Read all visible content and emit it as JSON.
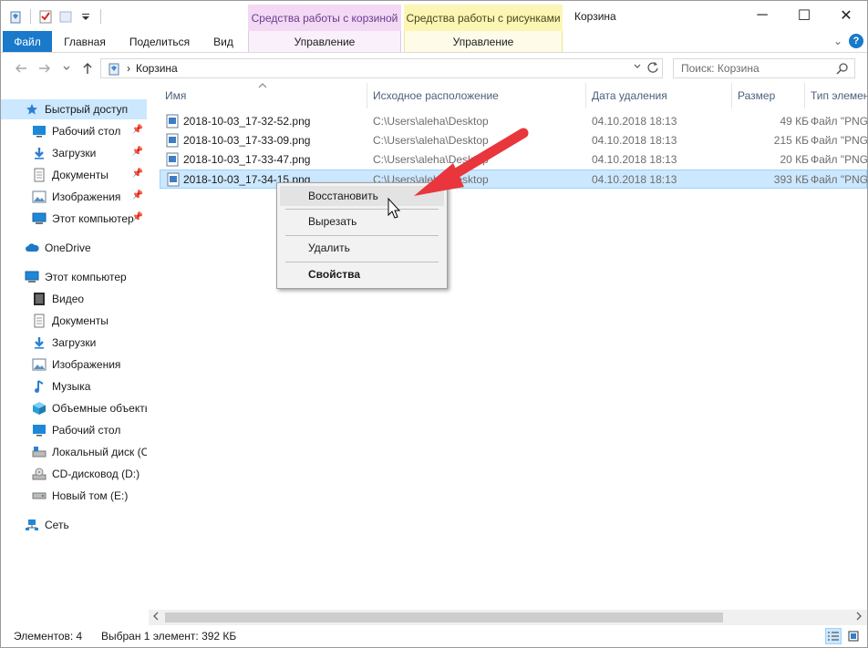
{
  "window": {
    "title": "Корзина",
    "minimize": "─",
    "maximize": "☐",
    "close": "✕"
  },
  "context_tabs": {
    "recycle_tools": "Средства работы с корзиной",
    "picture_tools": "Средства работы с рисунками"
  },
  "ribbon": {
    "file": "Файл",
    "home": "Главная",
    "share": "Поделиться",
    "view": "Вид",
    "manage1": "Управление",
    "manage2": "Управление",
    "collapse": "⌄",
    "help": "?"
  },
  "address": {
    "separator": "›",
    "location": "Корзина",
    "search_placeholder": "Поиск: Корзина"
  },
  "nav": {
    "quick_access": "Быстрый доступ",
    "desktop_pinned": "Рабочий стол",
    "downloads_pinned": "Загрузки",
    "documents_pinned": "Документы",
    "images_pinned": "Изображения",
    "this_pc_pinned": "Этот компьютер",
    "onedrive": "OneDrive",
    "this_pc": "Этот компьютер",
    "video": "Видео",
    "documents": "Документы",
    "downloads": "Загрузки",
    "images": "Изображения",
    "music": "Музыка",
    "objects3d": "Объемные объекты",
    "desktop": "Рабочий стол",
    "local_disk": "Локальный диск (C:)",
    "cd_drive": "CD-дисковод (D:)",
    "new_volume": "Новый том (E:)",
    "network": "Сеть"
  },
  "columns": {
    "name": "Имя",
    "origin": "Исходное расположение",
    "deleted": "Дата удаления",
    "size": "Размер",
    "type": "Тип элемента"
  },
  "files": [
    {
      "name": "2018-10-03_17-32-52.png",
      "origin": "C:\\Users\\aleha\\Desktop",
      "deleted": "04.10.2018 18:13",
      "size": "49 КБ",
      "type": "Файл \"PNG\""
    },
    {
      "name": "2018-10-03_17-33-09.png",
      "origin": "C:\\Users\\aleha\\Desktop",
      "deleted": "04.10.2018 18:13",
      "size": "215 КБ",
      "type": "Файл \"PNG\""
    },
    {
      "name": "2018-10-03_17-33-47.png",
      "origin": "C:\\Users\\aleha\\Desktop",
      "deleted": "04.10.2018 18:13",
      "size": "20 КБ",
      "type": "Файл \"PNG\""
    },
    {
      "name": "2018-10-03_17-34-15.png",
      "origin": "C:\\Users\\aleha\\Desktop",
      "deleted": "04.10.2018 18:13",
      "size": "393 КБ",
      "type": "Файл \"PNG\""
    }
  ],
  "context_menu": {
    "restore": "Восстановить",
    "cut": "Вырезать",
    "delete": "Удалить",
    "properties": "Свойства"
  },
  "status": {
    "items": "Элементов: 4",
    "selected": "Выбран 1 элемент: 392 КБ"
  },
  "colors": {
    "accent": "#1979ca",
    "selection": "#cce8ff",
    "annotation_arrow": "#e8363c"
  }
}
